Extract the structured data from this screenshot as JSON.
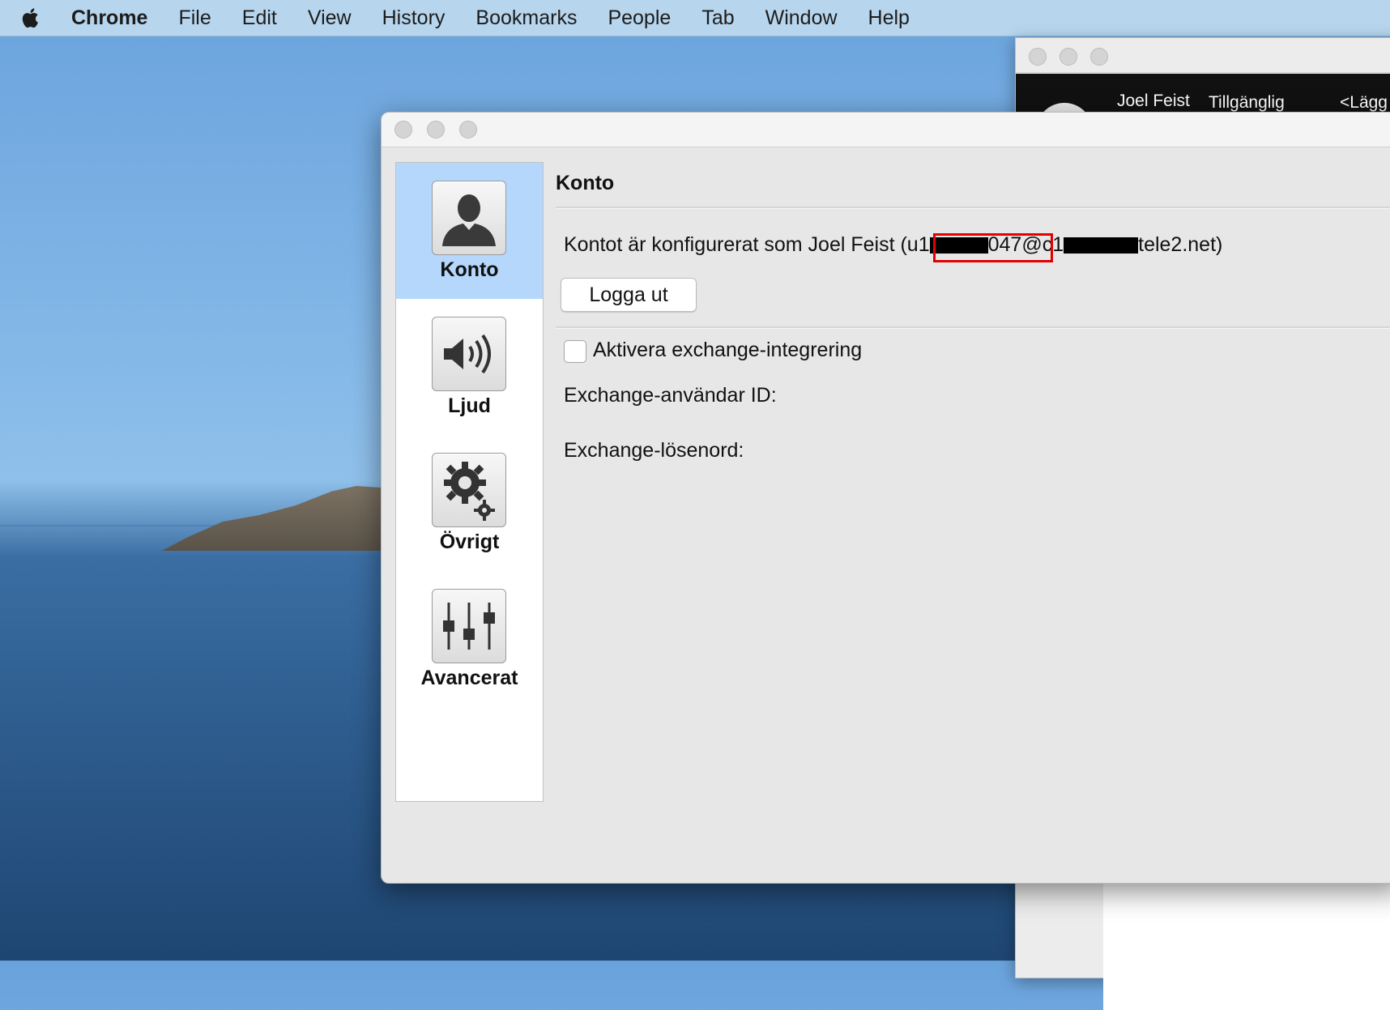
{
  "menubar": {
    "app": "Chrome",
    "items": [
      "File",
      "Edit",
      "View",
      "History",
      "Bookmarks",
      "People",
      "Tab",
      "Window",
      "Help"
    ]
  },
  "background_window": {
    "name": "Joel Feist",
    "status": "Tillgänglig",
    "add": "<Lägg"
  },
  "sidebar": {
    "items": [
      {
        "label": "Konto",
        "icon": "user-icon",
        "selected": true
      },
      {
        "label": "Ljud",
        "icon": "speaker-icon",
        "selected": false
      },
      {
        "label": "Övrigt",
        "icon": "gear-icon",
        "selected": false
      },
      {
        "label": "Avancerat",
        "icon": "sliders-icon",
        "selected": false
      }
    ]
  },
  "content": {
    "title": "Konto",
    "account_prefix": "Kontot är konfigurerat som Joel Feist (",
    "account_user_start": "u1",
    "account_user_end": "047",
    "account_host_start": "@c1",
    "account_host_end": "tele2.net)",
    "logout_label": "Logga ut",
    "exchange_checkbox_label": "Aktivera exchange-integrering",
    "exchange_user_label": "Exchange-användar ID:",
    "exchange_password_label": "Exchange-lösenord:"
  },
  "colors": {
    "selection": "#b5d7fb",
    "highlight": "#e20000"
  }
}
